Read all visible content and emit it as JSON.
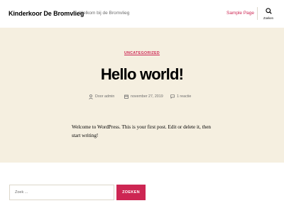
{
  "header": {
    "site_title": "Kinderkoor De Bromvlieg",
    "site_description": "Welkom bij de Bromvlieg",
    "nav": [
      {
        "label": "Sample Page"
      }
    ],
    "search_toggle_label": "Zoeken"
  },
  "post": {
    "category": "UNCATEGORIZED",
    "title": "Hello world!",
    "meta": {
      "author": "Door admin",
      "date": "november 27, 2019",
      "comments": "1 reactie"
    },
    "body": "Welcome to WordPress. This is your first post. Edit or delete it, then start writing!"
  },
  "footer_search": {
    "placeholder": "Zoek ...",
    "button_label": "ZOEKEN"
  },
  "colors": {
    "accent": "#cd2653",
    "hero_background": "#f5efe0",
    "meta_text": "#6d6d6d"
  },
  "icons": [
    "search-icon",
    "user-icon",
    "calendar-icon",
    "comment-icon"
  ]
}
